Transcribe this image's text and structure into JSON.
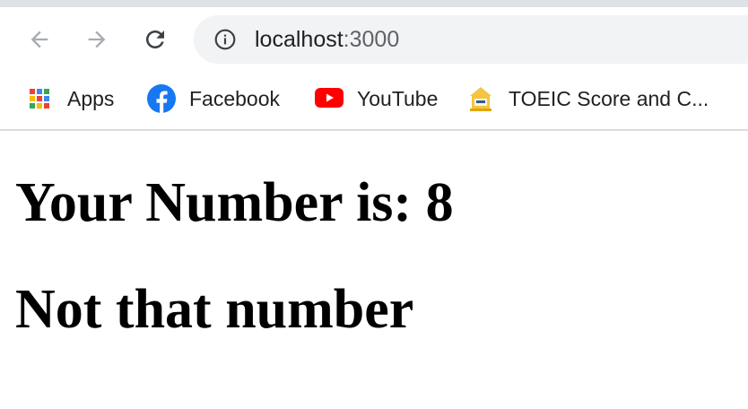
{
  "browser": {
    "address_bar": {
      "host": "localhost",
      "port": ":3000"
    },
    "nav_icons": [
      "back-icon",
      "forward-icon",
      "reload-icon"
    ],
    "bookmarks": [
      {
        "label": "Apps",
        "icon": "apps-grid-icon"
      },
      {
        "label": "Facebook",
        "icon": "facebook-icon"
      },
      {
        "label": "YouTube",
        "icon": "youtube-icon"
      },
      {
        "label": "TOEIC Score and C...",
        "icon": "toeic-icon"
      }
    ],
    "colors": {
      "tab_strip": "#dee1e6",
      "omnibox_bg": "#f1f3f4",
      "facebook_blue": "#1877f2",
      "youtube_red": "#ff0000"
    }
  },
  "page": {
    "heading_number": "Your Number is: 8",
    "heading_result": "Not that number"
  }
}
